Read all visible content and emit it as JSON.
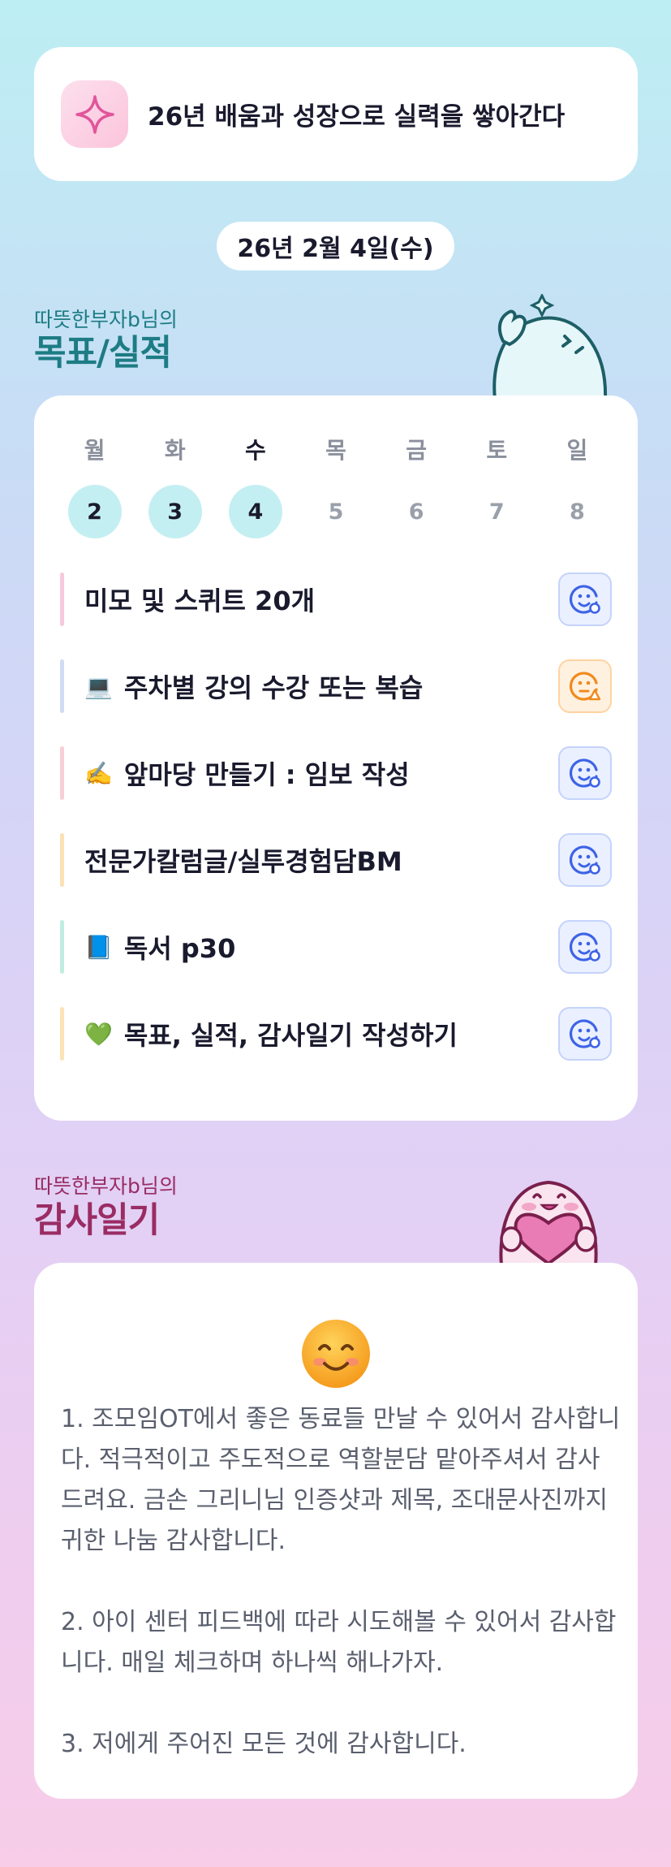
{
  "goal": {
    "icon": "sparkle-icon",
    "text": "26년 배움과 성장으로 실력을 쌓아간다"
  },
  "date": "26년 2월 4일(수)",
  "plan_section": {
    "owner": "따뜻한부자b님의",
    "title": "목표/실적"
  },
  "week": [
    {
      "label": "월",
      "num": "2",
      "done": true
    },
    {
      "label": "화",
      "num": "3",
      "done": true
    },
    {
      "label": "수",
      "num": "4",
      "done": true,
      "today": true
    },
    {
      "label": "목",
      "num": "5",
      "done": false
    },
    {
      "label": "금",
      "num": "6",
      "done": false
    },
    {
      "label": "토",
      "num": "7",
      "done": false
    },
    {
      "label": "일",
      "num": "8",
      "done": false
    }
  ],
  "tasks": [
    {
      "emoji": "",
      "label": "미모 및 스퀴트 20개",
      "bar_color": "#f6c9dc",
      "status": "smile-check-icon"
    },
    {
      "emoji": "💻",
      "label": "주차별 강의 수강 또는 복습",
      "bar_color": "#cfdcf3",
      "status": "smile-warning-icon"
    },
    {
      "emoji": "✍️",
      "label": "앞마당 만들기 : 임보 작성",
      "bar_color": "#f8cfd6",
      "status": "smile-check-icon"
    },
    {
      "emoji": "",
      "label": "전문가칼럼글/실투경험담BM",
      "bar_color": "#fbe1b4",
      "status": "smile-check-icon"
    },
    {
      "emoji": "📘",
      "label": "독서 p30",
      "bar_color": "#bfeee1",
      "status": "smile-check-icon"
    },
    {
      "emoji": "💚",
      "label": "목표, 실적, 감사일기 작성하기",
      "bar_color": "#fbe3b8",
      "status": "smile-check-icon"
    }
  ],
  "diary_section": {
    "owner": "따뜻한부자b님의",
    "title": "감사일기"
  },
  "diary": {
    "emoji": "smiling-face-icon",
    "paragraphs": [
      "1. 조모임OT에서 좋은 동료들 만날 수 있어서 감사합니다. 적극적이고 주도적으로 역할분담 맡아주셔서 감사드려요. 금손 그리니님 인증샷과 제목, 조대문사진까지 귀한 나눔 감사합니다.",
      "2. 아이 센터 피드백에 따라 시도해볼 수 있어서 감사합니다. 매일 체크하며 하나씩 해나가자.",
      "3. 저에게 주어진 모든 것에 감사합니다."
    ]
  }
}
